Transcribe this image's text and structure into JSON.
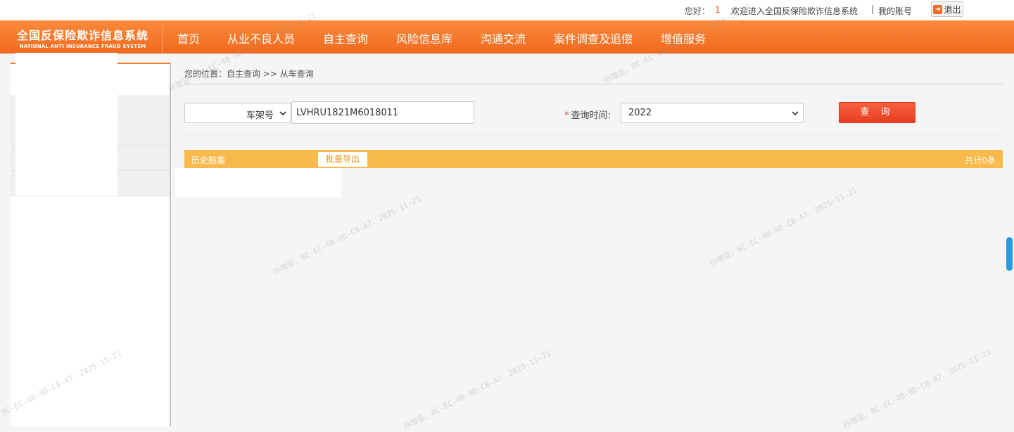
{
  "topbar": {
    "greeting": "您好：",
    "username": "1",
    "welcome": "欢迎进入全国反保险欺诈信息系统",
    "separator": "|",
    "my_account": "我的账号",
    "logout": "退出",
    "logout_icon": "exit-arrow-icon"
  },
  "brand": {
    "title_cn": "全国反保险欺诈信息系统",
    "title_en": "NATIONAL ANTI INSURANCE FRAUD SYSTEM"
  },
  "nav": {
    "items": [
      "首页",
      "从业不良人员",
      "自主查询",
      "风险信息库",
      "沟通交流",
      "案件调查及追偿",
      "增值服务"
    ]
  },
  "breadcrumb": "您的位置：自主查询 >> 从车查询",
  "search": {
    "type_selected": "车架号",
    "vin_value": "LVHRU1821M6018011",
    "time_required_mark": "*",
    "time_label": "查询时间:",
    "year_selected": "2022",
    "query_button": "查 询"
  },
  "results": {
    "title": "历史赔案",
    "export_button": "批量导出",
    "total": "共计0条"
  },
  "watermark": "孙增亚、8C-EC-4B-9D-C8-A7、2025-11-21",
  "colors": {
    "nav_orange": "#f47a2c",
    "result_bar": "#f8ba4d",
    "query_button": "#e8462a"
  }
}
